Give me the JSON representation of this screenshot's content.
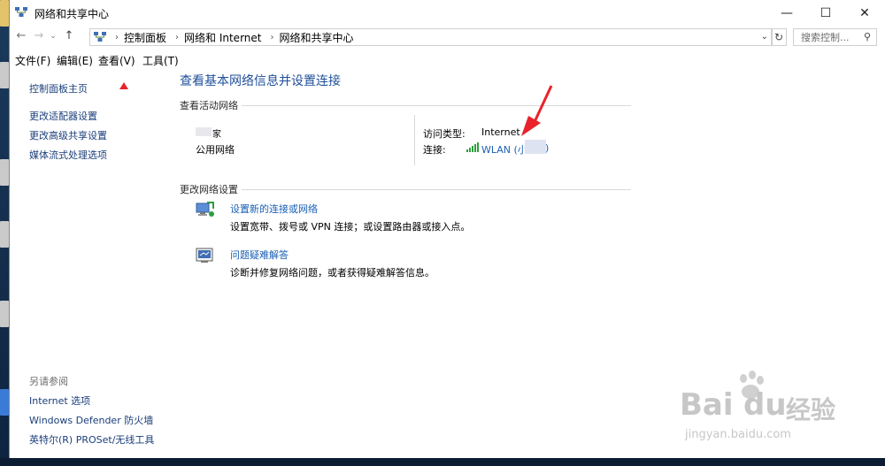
{
  "window": {
    "title": "网络和共享中心",
    "minimize": "—",
    "maximize": "☐",
    "close": "✕"
  },
  "address": {
    "crumbs": [
      "控制面板",
      "网络和 Internet",
      "网络和共享中心"
    ],
    "search_placeholder": "搜索控制..."
  },
  "menu": [
    "文件(F)",
    "编辑(E)",
    "查看(V)",
    "工具(T)"
  ],
  "left_pane": {
    "home": "控制面板主页",
    "links": [
      "更改适配器设置",
      "更改高级共享设置",
      "媒体流式处理选项"
    ],
    "see_also_head": "另请参阅",
    "see_also": [
      "Internet 选项",
      "Windows Defender 防火墙",
      "英特尔(R) PROSet/无线工具"
    ]
  },
  "main": {
    "title": "查看基本网络信息并设置连接",
    "active_networks_head": "查看活动网络",
    "network_name_partial": "家",
    "network_type": "公用网络",
    "access_type_label": "访问类型:",
    "access_type_value": "Internet",
    "connection_label": "连接:",
    "connection_value": "WLAN (小",
    "connection_tail": ")",
    "change_settings_head": "更改网络设置",
    "task1_link": "设置新的连接或网络",
    "task1_desc": "设置宽带、拨号或 VPN 连接；或设置路由器或接入点。",
    "task2_link": "问题疑难解答",
    "task2_desc": "诊断并修复网络问题，或者获得疑难解答信息。"
  },
  "watermark": {
    "brand": "Bai",
    "brand2": "du",
    "cn": "经验",
    "url": "jingyan.baidu.com"
  },
  "colors": {
    "link": "#1a5fb4",
    "title": "#1f4f9b",
    "arrow": "#e8232b"
  },
  "icons": {
    "app": "network-icon",
    "wifi": "wifi-signal-icon",
    "setup": "setup-connection-icon",
    "troubleshoot": "troubleshoot-icon"
  }
}
